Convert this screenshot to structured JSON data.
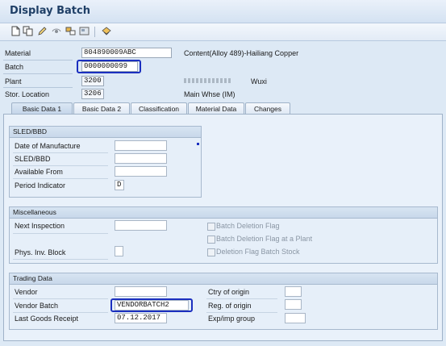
{
  "title": "Display Batch",
  "toolbar_icons": [
    "new-icon",
    "copy-icon",
    "edit-icon",
    "display-other-icon",
    "where-used-icon",
    "batch-info-icon",
    "print-icon"
  ],
  "header": {
    "material_label": "Material",
    "material_value": "804890009ABC",
    "material_desc": "Content(Alloy 489)-Hailiang Copper",
    "batch_label": "Batch",
    "batch_value": "0000000099",
    "plant_label": "Plant",
    "plant_value": "3200",
    "plant_desc": "Wuxi",
    "storloc_label": "Stor. Location",
    "storloc_value": "3206",
    "storloc_desc": "Main Whse (IM)"
  },
  "tabs": [
    "Basic Data 1",
    "Basic Data 2",
    "Classification",
    "Material Data",
    "Changes"
  ],
  "sled": {
    "title": "SLED/BBD",
    "date_of_manufacture": "Date of Manufacture",
    "sled_bbd": "SLED/BBD",
    "available_from": "Available From",
    "period_indicator": "Period Indicator",
    "period_indicator_value": "D"
  },
  "misc": {
    "title": "Miscellaneous",
    "next_inspection": "Next Inspection",
    "phys_inv_block": "Phys. Inv. Block",
    "batch_deletion_flag": "Batch Deletion Flag",
    "batch_deletion_flag_plant": "Batch Deletion Flag at a Plant",
    "deletion_flag_batch_stock": "Deletion Flag Batch Stock"
  },
  "trading": {
    "title": "Trading Data",
    "vendor": "Vendor",
    "vendor_batch": "Vendor Batch",
    "vendor_batch_value": "VENDORBATCH2",
    "last_goods_receipt": "Last Goods Receipt",
    "last_goods_receipt_value": "07.12.2017",
    "ctry_of_origin": "Ctry of origin",
    "reg_of_origin": "Reg. of origin",
    "exp_imp_group": "Exp/imp group"
  }
}
